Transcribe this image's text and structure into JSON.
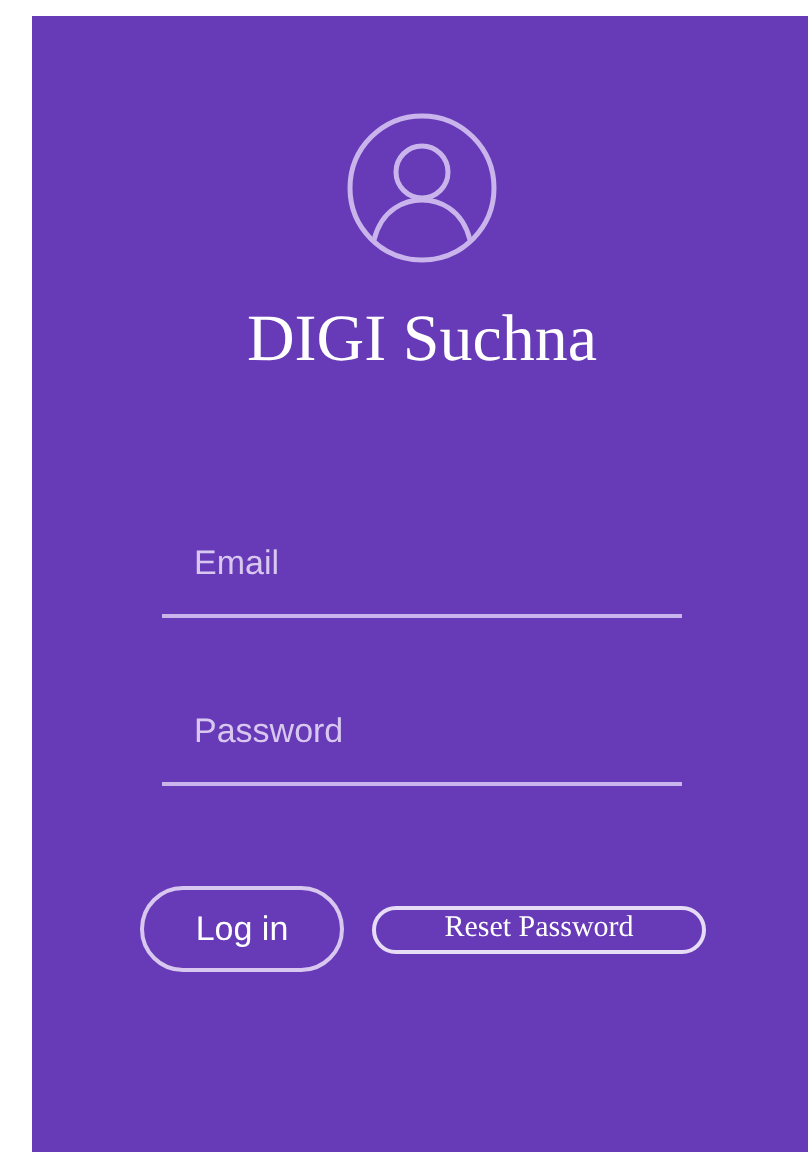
{
  "title": "DIGI Suchna",
  "fields": [
    {
      "placeholder": "Email"
    },
    {
      "placeholder": "Password"
    }
  ],
  "buttons": [
    {
      "label": "Log in",
      "kind": "primary"
    },
    {
      "label": "Reset Password",
      "kind": "secondary"
    }
  ]
}
